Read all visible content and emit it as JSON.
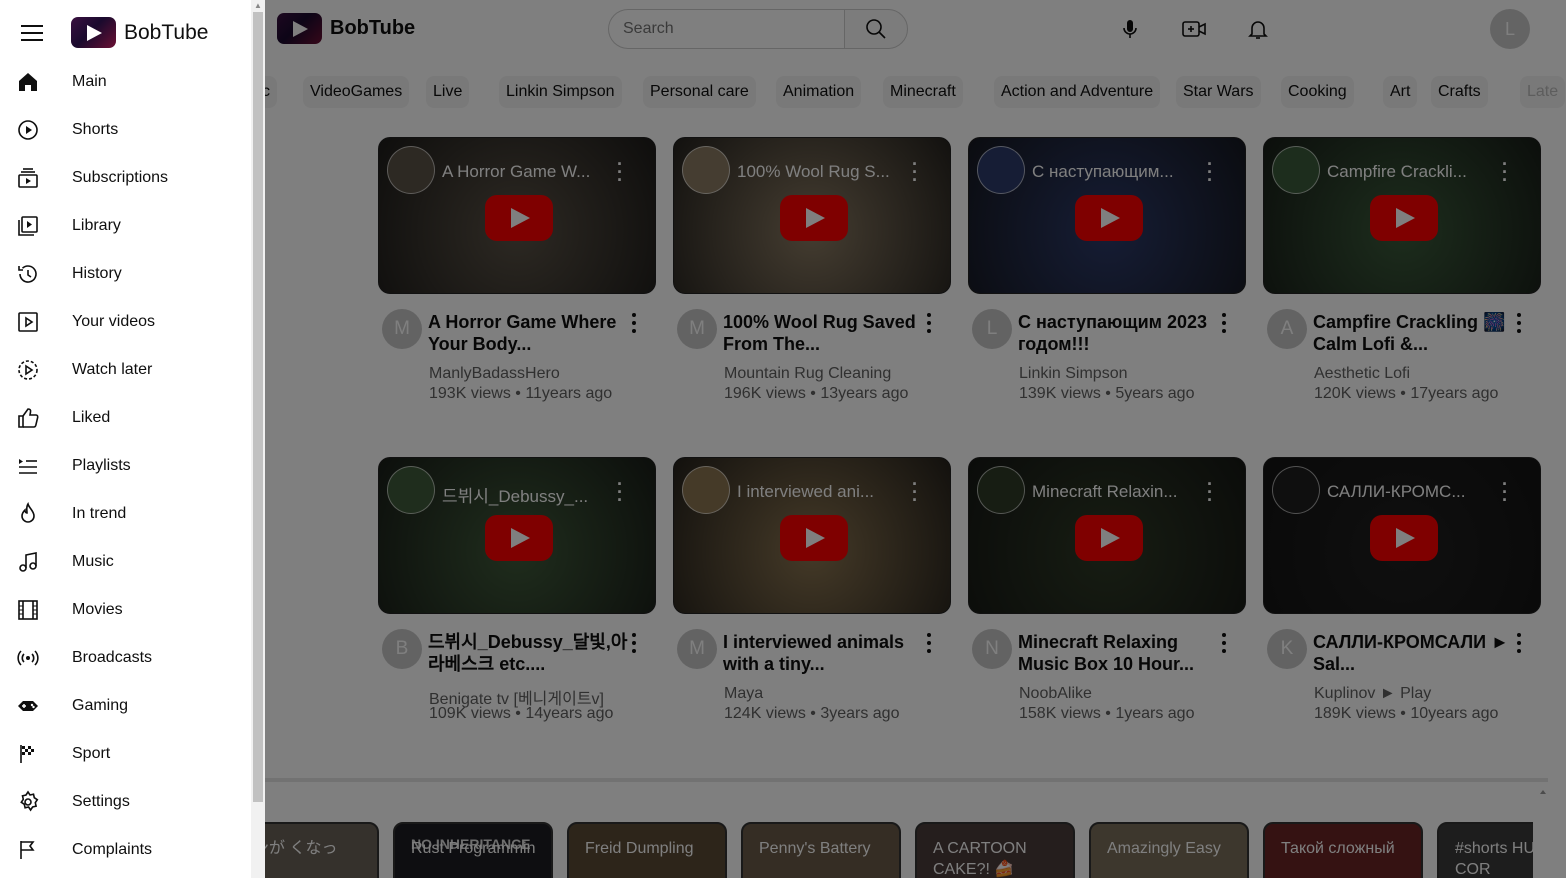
{
  "app": {
    "name": "BobTube"
  },
  "header": {
    "search_placeholder": "Search",
    "avatar_letter": "L"
  },
  "chips": [
    "c",
    "VideoGames",
    "Live",
    "Linkin Simpson",
    "Personal care",
    "Animation",
    "Minecraft",
    "Action and Adventure",
    "Star Wars",
    "Cooking",
    "Art",
    "Crafts",
    "Late"
  ],
  "videos": [
    {
      "thumb_title": "A Horror Game W...",
      "title": "A Horror Game Where Your Body...",
      "avatar": "M",
      "channel": "ManlyBadassHero",
      "meta": "193K views • 11years ago",
      "thumb_color": "#5a5246"
    },
    {
      "thumb_title": "100% Wool Rug S...",
      "title": "100% Wool Rug Saved From The...",
      "avatar": "M",
      "channel": "Mountain Rug Cleaning",
      "meta": "196K views • 13years ago",
      "thumb_color": "#8a7a62"
    },
    {
      "thumb_title": "С наступающим...",
      "title": "С наступающим 2023 годом!!!",
      "avatar": "L",
      "channel": "Linkin Simpson",
      "meta": "139K views • 5years ago",
      "thumb_color": "#2c3a6a"
    },
    {
      "thumb_title": "Campfire Crackli...",
      "title": "Campfire Crackling 🎆 Calm Lofi &...",
      "avatar": "A",
      "channel": "Aesthetic Lofi",
      "meta": "120K views • 17years ago",
      "thumb_color": "#3a5a3a"
    },
    {
      "thumb_title": "드뷔시_Debussy_...",
      "title": "드뷔시_Debussy_달빛,아라베스크 etc....",
      "avatar": "B",
      "channel": "Benigate tv [베니게이트v]",
      "meta": "109K views • 14years ago",
      "thumb_color": "#3f5a3a"
    },
    {
      "thumb_title": "I interviewed ani...",
      "title": "I interviewed animals with a tiny...",
      "avatar": "M",
      "channel": "Maya",
      "meta": "124K views • 3years ago",
      "thumb_color": "#8a7450"
    },
    {
      "thumb_title": "Minecraft Relaxin...",
      "title": "Minecraft Relaxing Music Box 10 Hour...",
      "avatar": "N",
      "channel": "NoobAlike",
      "meta": "158K views • 1years ago",
      "thumb_color": "#2e3a26"
    },
    {
      "thumb_title": "САЛЛИ-КРОМС...",
      "title": "САЛЛИ-КРОМСАЛИ ► Sal...",
      "avatar": "K",
      "channel": "Kuplinov ► Play",
      "meta": "189K views • 10years ago",
      "thumb_color": "#1f1f1f"
    }
  ],
  "shorts": [
    {
      "title": "コンが くなっ",
      "color": "#6b6258"
    },
    {
      "title": "Rust Programmin",
      "badge": "NO INHERITANCE",
      "color": "#1d1d22"
    },
    {
      "title": "Freid Dumpling",
      "color": "#5a4a34"
    },
    {
      "title": "Penny's Battery",
      "color": "#6a5a48"
    },
    {
      "title": "A CARTOON CAKE?! 🍰",
      "color": "#4a3c3a"
    },
    {
      "title": "Amazingly Easy",
      "color": "#7a6e5a"
    },
    {
      "title": "Такой сложный",
      "color": "#6a2424"
    },
    {
      "title": "#shorts HUGE COR",
      "color": "#3a3a3a"
    }
  ],
  "sidebar": {
    "items": [
      {
        "label": "Main",
        "icon": "home-icon"
      },
      {
        "label": "Shorts",
        "icon": "shorts-icon"
      },
      {
        "label": "Subscriptions",
        "icon": "subscriptions-icon"
      },
      {
        "label": "Library",
        "icon": "library-icon"
      },
      {
        "label": "History",
        "icon": "history-icon"
      },
      {
        "label": "Your videos",
        "icon": "your-videos-icon"
      },
      {
        "label": "Watch later",
        "icon": "watch-later-icon"
      },
      {
        "label": "Liked",
        "icon": "thumbs-up-icon"
      },
      {
        "label": "Playlists",
        "icon": "playlists-icon"
      },
      {
        "label": "In trend",
        "icon": "flame-icon"
      },
      {
        "label": "Music",
        "icon": "music-note-icon"
      },
      {
        "label": "Movies",
        "icon": "film-icon"
      },
      {
        "label": "Broadcasts",
        "icon": "broadcast-icon"
      },
      {
        "label": "Gaming",
        "icon": "gamepad-icon"
      },
      {
        "label": "Sport",
        "icon": "flag-checkered-icon"
      },
      {
        "label": "Settings",
        "icon": "gear-icon"
      },
      {
        "label": "Complaints",
        "icon": "flag-icon"
      }
    ]
  }
}
